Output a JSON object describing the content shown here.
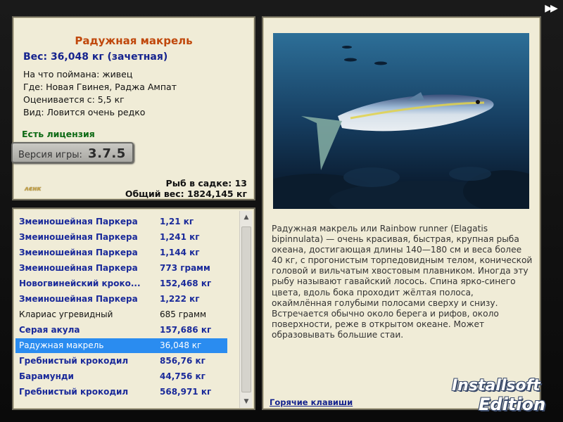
{
  "nav": {
    "next_icon": "double-right-arrow",
    "next_glyph": "▶▶"
  },
  "info": {
    "fish_name": "Радужная макрель",
    "weight_line": "Вес: 36,048 кг (зачетная)",
    "caught_on": "На что поймана: живец",
    "location": "Где: Новая Гвинея, Раджа Ампат",
    "rated_from": "Оценивается с: 5,5 кг",
    "rarity": "Вид: Ловится очень редко",
    "license": "Есть лицензия",
    "version_label": "Версия игры:",
    "version_value": "3.7.5",
    "logo_text": "ᴧєнк",
    "cage_count": "Рыб в садке: 13",
    "total_weight": "Общий вес: 1824,145 кг"
  },
  "catch_list": [
    {
      "name": "Змеиношейная Паркера",
      "weight": "1,21 кг",
      "style": "bold"
    },
    {
      "name": "Змеиношейная Паркера",
      "weight": "1,241 кг",
      "style": "bold"
    },
    {
      "name": "Змеиношейная Паркера",
      "weight": "1,144 кг",
      "style": "bold"
    },
    {
      "name": "Змеиношейная Паркера",
      "weight": "773 грамм",
      "style": "bold"
    },
    {
      "name": "Новогвинейский кроко...",
      "weight": "152,468 кг",
      "style": "bold"
    },
    {
      "name": "Змеиношейная Паркера",
      "weight": "1,222 кг",
      "style": "bold"
    },
    {
      "name": "Клариас угревидный",
      "weight": "685 грамм",
      "style": "plain"
    },
    {
      "name": "Серая акула",
      "weight": "157,686 кг",
      "style": "bold"
    },
    {
      "name": "Радужная макрель",
      "weight": "36,048 кг",
      "style": "selected"
    },
    {
      "name": "Гребнистый крокодил",
      "weight": "856,76 кг",
      "style": "bold"
    },
    {
      "name": "Барамунди",
      "weight": "44,756 кг",
      "style": "bold"
    },
    {
      "name": "Гребнистый крокодил",
      "weight": "568,971 кг",
      "style": "bold"
    }
  ],
  "description": "Радужная макрель или Rainbow runner (Elagatis bipinnulata) — очень красивая, быстрая, крупная рыба океана, достигающая длины 140—180 см и веса более 40 кг, с прогонистым торпедовидным телом, конической головой и вильчатым хвостовым плавником. Иногда эту рыбу называют гавайский лосось. Спина ярко-синего цвета, вдоль бока проходит жёлтая полоса, окаймлённая голубыми полосами сверху и снизу. Встречается обычно около берега и рифов, около поверхности, реже в открытом океане. Может образовывать большие стаи.",
  "hotkeys_label": "Горячие клавиши",
  "watermark": {
    "line1": "Installsoft",
    "line2": "Edition"
  },
  "colors": {
    "panel_bg": "#f0ecd7",
    "fish_name": "#c0480c",
    "weight_blue": "#15238e",
    "license_green": "#0d6a14",
    "selection": "#2a8cf0"
  }
}
